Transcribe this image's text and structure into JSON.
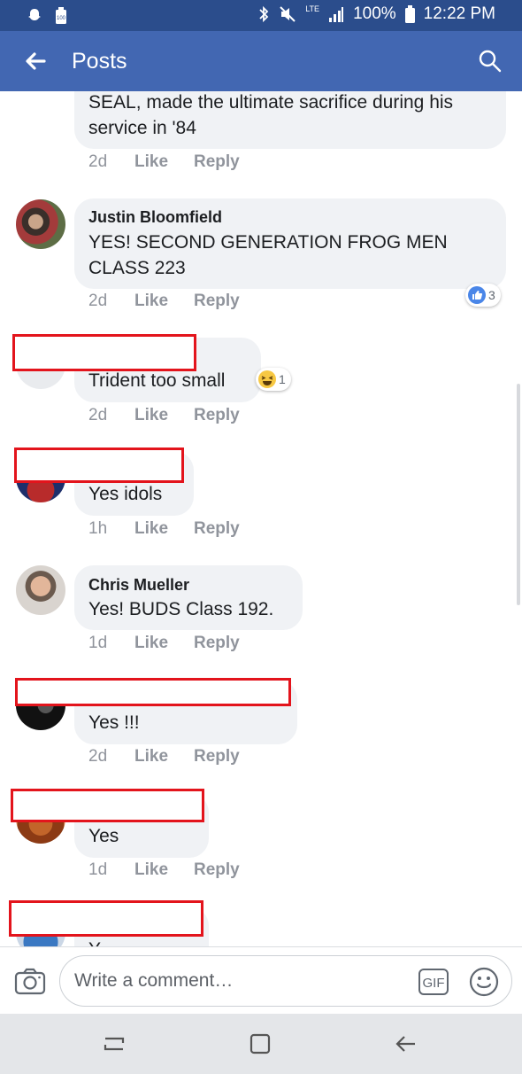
{
  "status_bar": {
    "battery": "100%",
    "time": "12:22 PM",
    "network": "LTE",
    "icons": [
      "snapchat-icon",
      "battery-saver-icon",
      "bluetooth-icon",
      "mute-icon",
      "signal-icon",
      "battery-icon"
    ]
  },
  "header": {
    "title": "Posts",
    "back_icon": "arrow-left-icon",
    "search_icon": "search-icon"
  },
  "comments": [
    {
      "id": "c0",
      "name": "",
      "text_lines": [
        "SEAL, made the ultimate sacrifice during his",
        "service in '84"
      ],
      "time": "2d",
      "like": "Like",
      "reply": "Reply"
    },
    {
      "id": "c1",
      "name": "Justin Bloomfield",
      "text_lines": [
        "YES! SECOND GENERATION FROG MEN",
        "CLASS 223"
      ],
      "time": "2d",
      "like": "Like",
      "reply": "Reply",
      "reaction": {
        "type": "like",
        "count": "3"
      }
    },
    {
      "id": "c2",
      "name": "",
      "text_lines": [
        "Trident too small"
      ],
      "time": "2d",
      "like": "Like",
      "reply": "Reply",
      "reaction": {
        "type": "haha",
        "count": "1"
      }
    },
    {
      "id": "c3",
      "name": "",
      "text_lines": [
        "Yes idols"
      ],
      "time": "1h",
      "like": "Like",
      "reply": "Reply"
    },
    {
      "id": "c4",
      "name": "Chris Mueller",
      "text_lines": [
        "Yes! BUDS Class 192."
      ],
      "time": "1d",
      "like": "Like",
      "reply": "Reply"
    },
    {
      "id": "c5",
      "name": "",
      "text_lines": [
        "Yes !!!"
      ],
      "time": "2d",
      "like": "Like",
      "reply": "Reply"
    },
    {
      "id": "c6",
      "name": "",
      "text_lines": [
        "Yes"
      ],
      "time": "1d",
      "like": "Like",
      "reply": "Reply"
    },
    {
      "id": "c7",
      "name": "",
      "text_lines": [
        "Y"
      ],
      "time": "",
      "like": "",
      "reply": ""
    }
  ],
  "composer": {
    "placeholder": "Write a comment…",
    "camera_icon": "camera-icon",
    "gif_label": "GIF",
    "emoji_icon": "smiley-icon"
  },
  "system_nav": {
    "icons": [
      "recent-apps-icon",
      "home-icon",
      "back-icon"
    ]
  },
  "colors": {
    "header_blue": "#4267b2",
    "status_blue": "#2b4d8c",
    "bubble_gray": "#f0f2f5",
    "meta_gray": "#90949c",
    "redaction_red": "#e3141c"
  }
}
